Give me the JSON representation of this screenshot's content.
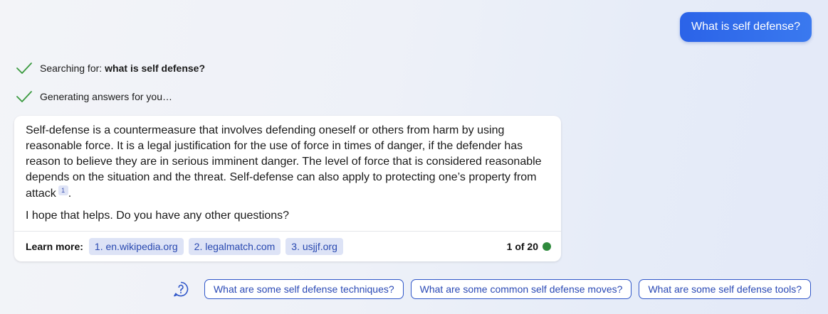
{
  "user_message": "What is self defense?",
  "status": [
    {
      "prefix": "Searching for:",
      "query": "what is self defense?",
      "icon": "checkmark-icon"
    },
    {
      "prefix": "Generating answers for you…",
      "query": "",
      "icon": "checkmark-icon"
    }
  ],
  "answer": {
    "paragraph_1": "Self-defense is a countermeasure that involves defending oneself or others from harm by using reasonable force. It is a legal justification for the use of force in times of danger, if the defender has reason to believe they are in serious imminent danger. The level of force that is considered reasonable depends on the situation and the threat. Self-defense can also apply to protecting one’s property from attack",
    "citation": "1",
    "paragraph_1_end": ".",
    "paragraph_2": "I hope that helps. Do you have any other questions?"
  },
  "footer": {
    "learn_more_label": "Learn more:",
    "sources": [
      "1. en.wikipedia.org",
      "2. legalmatch.com",
      "3. usjjf.org"
    ],
    "turn_counter": "1 of 20"
  },
  "suggestions": [
    "What are some self defense techniques?",
    "What are some common self defense moves?",
    "What are some self defense tools?"
  ],
  "colors": {
    "accent": "#2b63e8",
    "check": "#3a9a3f",
    "turn_dot": "#2e8a3c",
    "chip_text": "#2848b0",
    "chip_bg": "#dde3f6"
  }
}
